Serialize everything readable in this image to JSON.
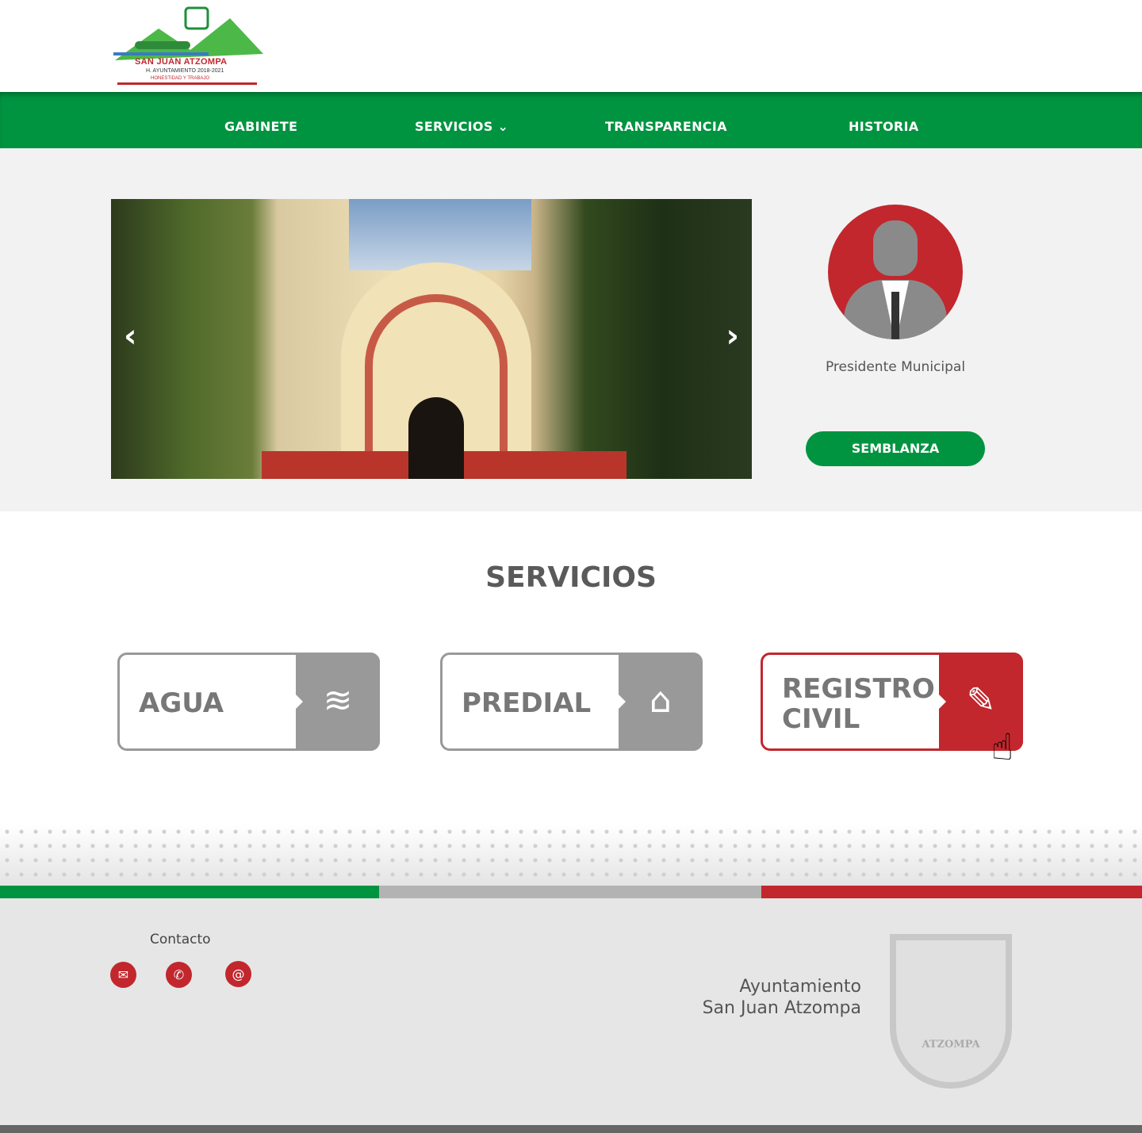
{
  "header": {
    "logo": {
      "name": "SAN JUAN ATZOMPA",
      "subtitle": "H. AYUNTAMIENTO 2018-2021",
      "motto": "HONESTIDAD Y TRABAJO"
    }
  },
  "nav": {
    "items": [
      {
        "label": "GABINETE"
      },
      {
        "label": "SERVICIOS ⌄"
      },
      {
        "label": "TRANSPARENCIA"
      },
      {
        "label": "HISTORIA"
      }
    ]
  },
  "hero": {
    "prev_icon": "chevron-left",
    "next_icon": "chevron-right",
    "president_label": "Presidente Municipal",
    "button_label": "SEMBLANZA"
  },
  "services": {
    "title": "SERVICIOS",
    "cards": [
      {
        "label": "AGUA",
        "icon": "water-waves"
      },
      {
        "label": "PREDIAL",
        "icon": "house"
      },
      {
        "label": "REGISTRO CIVIL",
        "icon": "document-pen"
      }
    ]
  },
  "colors": {
    "green": "#009440",
    "red": "#c1272d",
    "gray": "#999999"
  },
  "footer": {
    "contact_title": "Contacto",
    "contact_icons": [
      "envelope",
      "phone",
      "at-sign"
    ],
    "org_line1": "Ayuntamiento",
    "org_line2": "San Juan Atzompa",
    "shield_text": "ATZOMPA"
  }
}
